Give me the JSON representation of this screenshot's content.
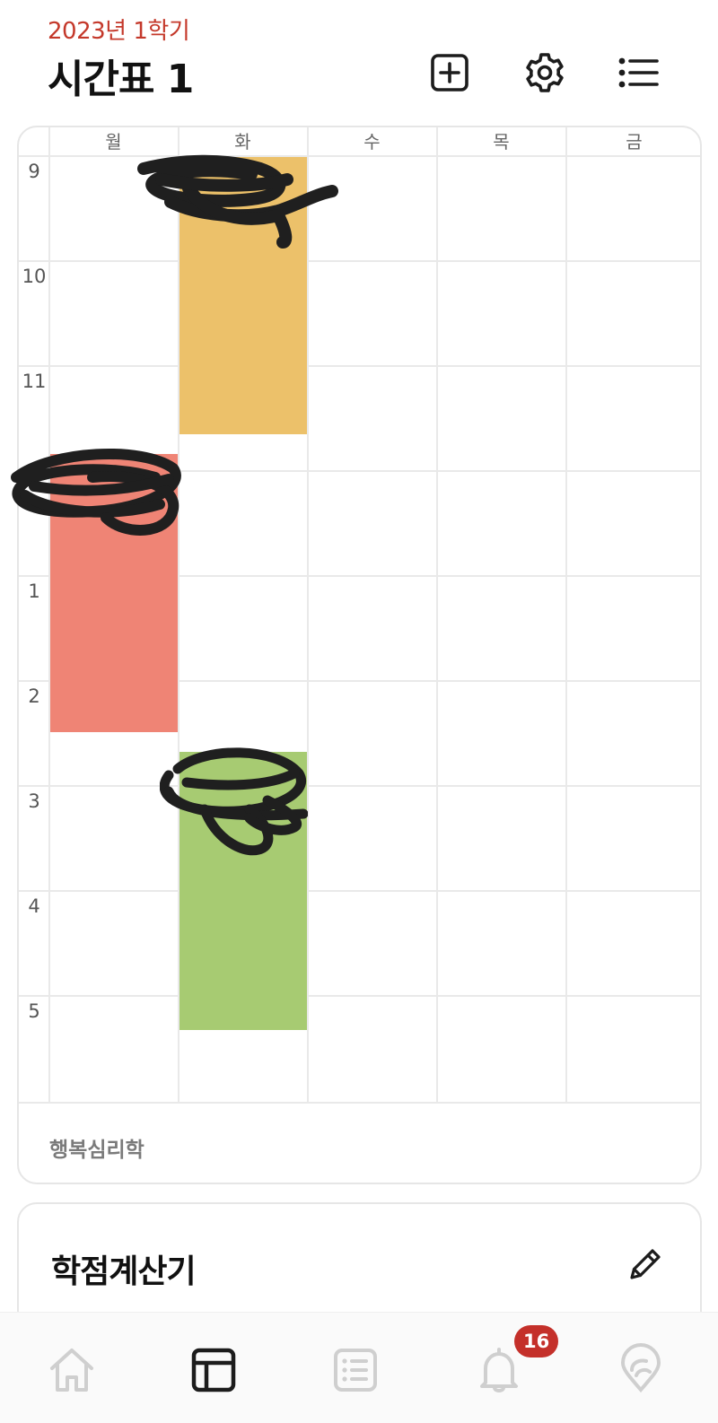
{
  "header": {
    "semester": "2023년 1학기",
    "title": "시간표 1",
    "icons": [
      "add-square-icon",
      "gear-icon",
      "list-icon"
    ]
  },
  "timetable": {
    "days": [
      "월",
      "화",
      "수",
      "목",
      "금"
    ],
    "hours": [
      "9",
      "10",
      "11",
      "12",
      "1",
      "2",
      "3",
      "4",
      "5"
    ],
    "courses": [
      {
        "day": "화",
        "start": "9:00",
        "end": "11:40",
        "color": "#ecc16a",
        "label_redacted": true
      },
      {
        "day": "월",
        "start": "11:50",
        "end": "2:30",
        "color": "#ef8475",
        "label_redacted": true
      },
      {
        "day": "화",
        "start": "2:40",
        "end": "5:20",
        "color": "#a7cb72",
        "label_redacted": true
      }
    ],
    "unassigned_courses": [
      "행복심리학"
    ]
  },
  "grade_calculator": {
    "title": "학점계산기",
    "icon": "pencil-icon"
  },
  "bottom_nav": {
    "items": [
      "home-icon",
      "timetable-icon",
      "board-icon",
      "bell-icon",
      "campus-pick-icon"
    ],
    "active": "timetable-icon",
    "notification_count": "16"
  },
  "colors": {
    "accent": "#c4382a",
    "yellow": "#ecc16a",
    "red": "#ef8475",
    "green": "#a7cb72"
  }
}
